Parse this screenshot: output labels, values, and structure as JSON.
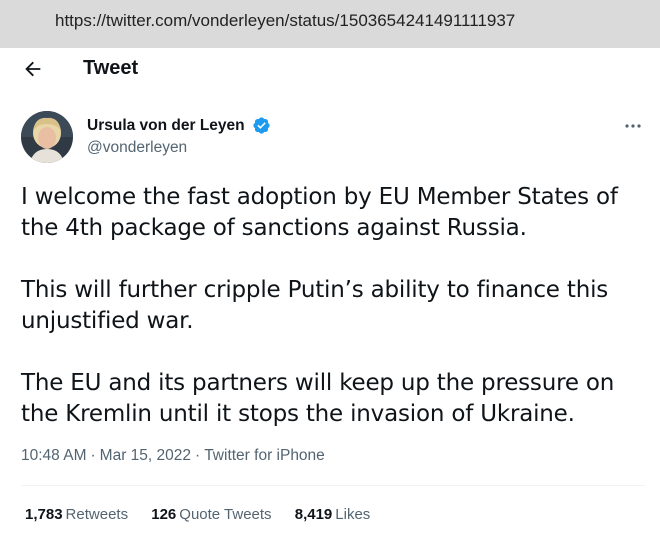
{
  "browser": {
    "url": "https://twitter.com/vonderleyen/status/1503654241491111937"
  },
  "header": {
    "back_icon": "arrow-left-icon",
    "title": "Tweet"
  },
  "author": {
    "display_name": "Ursula von der Leyen",
    "handle": "@vonderleyen",
    "verified_icon": "verified-badge-icon",
    "more_icon": "ellipsis-icon"
  },
  "tweet": {
    "paragraphs": [
      "I welcome the fast adoption by EU Member States of the 4th package of sanctions against Russia.",
      "This will further cripple Putin’s ability to finance this unjustified war.",
      "The EU and its partners will keep up the pressure on the Kremlin until it stops the invasion of Ukraine."
    ],
    "time": "10:48 AM",
    "date": "Mar 15, 2022",
    "source": "Twitter for iPhone",
    "separator": "·"
  },
  "stats": {
    "retweets": {
      "count": "1,783",
      "label": "Retweets"
    },
    "quote_tweets": {
      "count": "126",
      "label": "Quote Tweets"
    },
    "likes": {
      "count": "8,419",
      "label": "Likes"
    }
  },
  "colors": {
    "primary_text": "#0f1419",
    "secondary_text": "#536471",
    "verified_blue": "#1d9bf0",
    "url_bar_bg": "#dadada"
  }
}
